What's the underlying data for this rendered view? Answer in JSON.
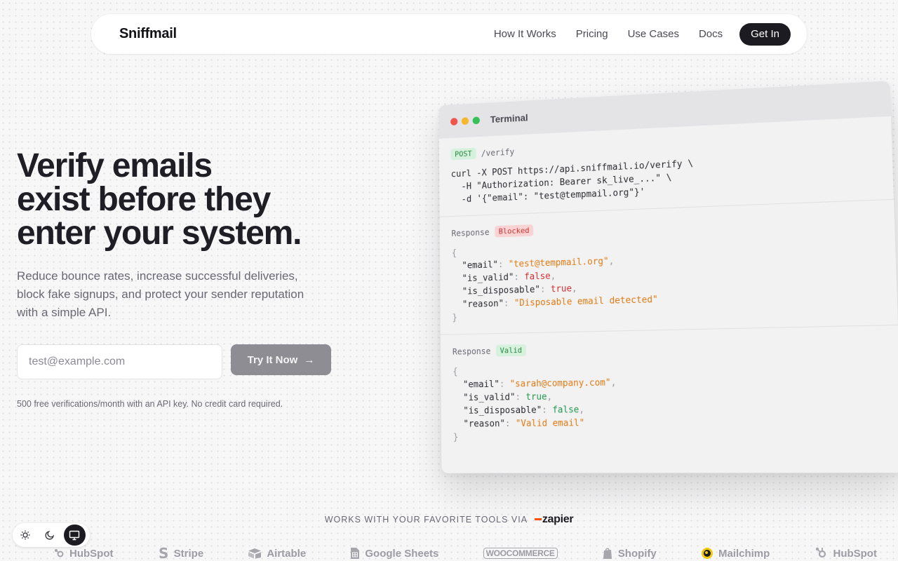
{
  "brand": {
    "name": "Sniffmail"
  },
  "nav": {
    "links": [
      "How It Works",
      "Pricing",
      "Use Cases",
      "Docs"
    ],
    "cta": "Get In"
  },
  "hero": {
    "title_lines": [
      "Verify emails",
      "exist before they",
      "enter your system."
    ],
    "subtitle": "Reduce bounce rates, increase successful deliveries, block fake signups, and protect your sender reputation with a simple API.",
    "email_placeholder": "test@example.com",
    "try_button": "Try It Now",
    "note": "500 free verifications/month with an API key. No credit card required."
  },
  "terminal": {
    "title": "Terminal",
    "request": {
      "method": "POST",
      "path": "/verify",
      "lines": [
        "curl -X POST https://api.sniffmail.io/verify \\",
        "  -H \"Authorization: Bearer sk_live_...\" \\",
        "  -d '{\"email\": \"test@tempmail.org\"}'"
      ]
    },
    "responses": [
      {
        "label": "Response",
        "status": "Blocked",
        "email": "\"test@tempmail.org\"",
        "is_valid": "false",
        "is_disposable": "true",
        "reason": "\"Disposable email detected\""
      },
      {
        "label": "Response",
        "status": "Valid",
        "email": "\"sarah@company.com\"",
        "is_valid": "true",
        "is_disposable": "false",
        "reason": "\"Valid email\""
      }
    ],
    "keys": {
      "email": "\"email\"",
      "is_valid": "\"is_valid\"",
      "is_disposable": "\"is_disposable\"",
      "reason": "\"reason\""
    }
  },
  "integrations": {
    "heading": "WORKS WITH YOUR FAVORITE TOOLS VIA",
    "via": "zapier",
    "tools": [
      "HubSpot",
      "Stripe",
      "Airtable",
      "Google Sheets",
      "WOOCOMMERCE",
      "Shopify",
      "Mailchimp",
      "HubSpot"
    ]
  },
  "theme": {
    "selected": "system"
  },
  "colors": {
    "accent_dark": "#1c1b21",
    "string_orange": "#e07a12",
    "bool_red": "#d02f2f",
    "bool_green": "#22994a",
    "zapier_orange": "#ff4f00"
  }
}
